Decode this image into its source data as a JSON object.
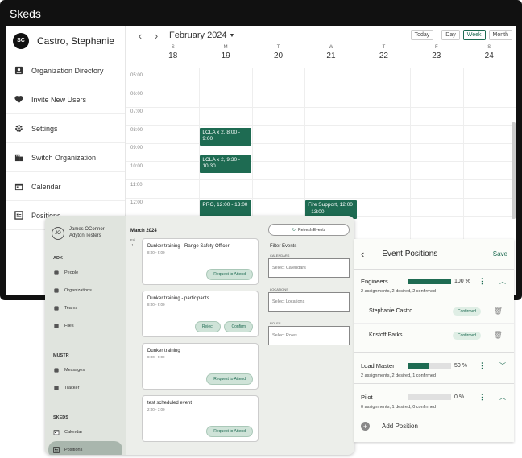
{
  "app": {
    "title": "Skeds"
  },
  "sidebar": {
    "user": {
      "initials": "SC",
      "name": "Castro, Stephanie"
    },
    "items": [
      {
        "label": "Organization Directory",
        "icon": "directory-icon"
      },
      {
        "label": "Invite New Users",
        "icon": "heart-icon"
      },
      {
        "label": "Settings",
        "icon": "gear-icon"
      },
      {
        "label": "Switch Organization",
        "icon": "building-icon"
      },
      {
        "label": "Calendar",
        "icon": "calendar-icon"
      },
      {
        "label": "Positions",
        "icon": "positions-icon"
      }
    ]
  },
  "calendar": {
    "month": "February 2024",
    "view_buttons": [
      "Today",
      "Day",
      "Week",
      "Month"
    ],
    "active_view": "Week",
    "days": [
      {
        "l": "S",
        "n": "18"
      },
      {
        "l": "M",
        "n": "19"
      },
      {
        "l": "T",
        "n": "20"
      },
      {
        "l": "W",
        "n": "21"
      },
      {
        "l": "T",
        "n": "22"
      },
      {
        "l": "F",
        "n": "23"
      },
      {
        "l": "S",
        "n": "24"
      }
    ],
    "hours": [
      "05:00",
      "06:00",
      "07:00",
      "08:00",
      "09:00",
      "10:00",
      "11:00",
      "12:00"
    ],
    "events": [
      {
        "text": "LCLA x 2, 8:00 - 9:00",
        "day": 1,
        "start": 8,
        "end": 9
      },
      {
        "text": "LCLA x 2, 9:30 - 10:30",
        "day": 1,
        "start": 9.5,
        "end": 10.5
      },
      {
        "text": "PRO, 12:00 - 13:00",
        "day": 1,
        "start": 12,
        "end": 13
      },
      {
        "text": "Fire Support, 12:00 - 13:00",
        "day": 3,
        "start": 12,
        "end": 13
      }
    ]
  },
  "tablet": {
    "user": {
      "initials": "JO",
      "name": "James OConnor",
      "org": "Adyton Testers"
    },
    "sections": [
      {
        "title": "ADK",
        "items": [
          "People",
          "Organizations",
          "Teams",
          "Files"
        ]
      },
      {
        "title": "MUSTR",
        "items": [
          "Messages",
          "Tracker"
        ]
      },
      {
        "title": "SKEDS",
        "items": [
          "Calendar",
          "Positions"
        ]
      }
    ],
    "month": "March 2024",
    "day_label": "Fri",
    "day_num": "1",
    "cards": [
      {
        "title": "Dunker training - Range Safety Officer",
        "time": "8:00 - 9:00",
        "buttons": [
          "Request to Attend"
        ]
      },
      {
        "title": "Dunker training - participants",
        "time": "8:00 - 9:00",
        "buttons": [
          "Reject",
          "Confirm"
        ]
      },
      {
        "title": "Dunker training",
        "time": "8:00 - 9:00",
        "buttons": [
          "Request to Attend"
        ]
      },
      {
        "title": "test scheduled event",
        "time": "2:00 - 3:00",
        "buttons": [
          "Request to Attend"
        ]
      }
    ],
    "refresh": "Refresh Events",
    "filter_title": "Filter Events",
    "filters": [
      {
        "label": "CALENDARS",
        "placeholder": "Select Calendars"
      },
      {
        "label": "LOCATIONS",
        "placeholder": "Select Locations"
      },
      {
        "label": "ROLES",
        "placeholder": "Select Roles"
      }
    ]
  },
  "positions": {
    "title": "Event Positions",
    "save": "Save",
    "list": [
      {
        "name": "Engineers",
        "pct": 100,
        "pct_label": "100 %",
        "summary": "2 assignments, 2 desired, 2 confirmed",
        "expanded": true,
        "assignees": [
          {
            "name": "Stephanie Castro",
            "status": "Confirmed"
          },
          {
            "name": "Kristoff Parks",
            "status": "Confirmed"
          }
        ]
      },
      {
        "name": "Load Master",
        "pct": 50,
        "pct_label": "50 %",
        "summary": "2 assignments, 2 desired, 1 confirmed",
        "expanded": false,
        "assignees": []
      },
      {
        "name": "Pilot",
        "pct": 0,
        "pct_label": "0 %",
        "summary": "0 assignments, 1 desired, 0 confirmed",
        "expanded": true,
        "assignees": []
      }
    ],
    "add": "Add Position"
  },
  "colors": {
    "accent": "#1e6b52"
  }
}
